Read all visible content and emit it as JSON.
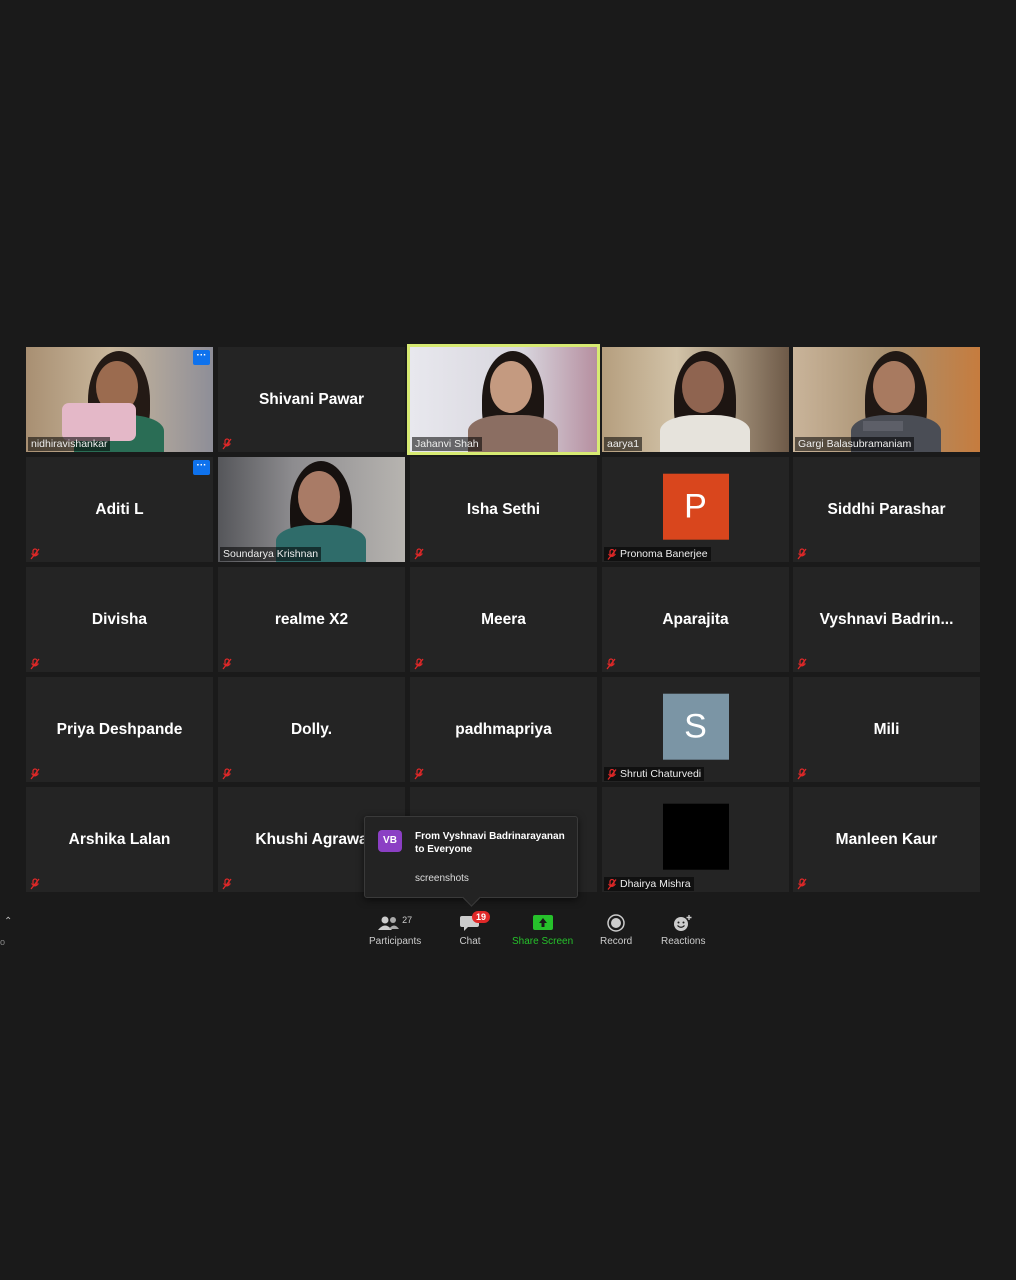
{
  "tiles": [
    {
      "name": "nidhiravishankar",
      "video": true,
      "muted": false,
      "more": true
    },
    {
      "name": "Shivani Pawar",
      "video": false,
      "muted": true
    },
    {
      "name": "Jahanvi Shah",
      "video": true,
      "muted": false,
      "active": true
    },
    {
      "name": "aarya1",
      "video": true,
      "muted": false
    },
    {
      "name": "Gargi Balasubramaniam",
      "video": true,
      "muted": false
    },
    {
      "name": "Aditi L",
      "video": false,
      "muted": true,
      "more": true
    },
    {
      "name": "Soundarya Krishnan",
      "video": true,
      "muted": false
    },
    {
      "name": "Isha Sethi",
      "video": false,
      "muted": true
    },
    {
      "name": "Pronoma Banerjee",
      "video": false,
      "muted": true,
      "avatar_letter": "P",
      "avatar_color": "#d9461d"
    },
    {
      "name": "Siddhi Parashar",
      "video": false,
      "muted": true
    },
    {
      "name": "Divisha",
      "video": false,
      "muted": true
    },
    {
      "name": "realme X2",
      "video": false,
      "muted": true
    },
    {
      "name": "Meera",
      "video": false,
      "muted": true
    },
    {
      "name": "Aparajita",
      "video": false,
      "muted": true
    },
    {
      "name": "Vyshnavi  Badrin...",
      "video": false,
      "muted": true
    },
    {
      "name": "Priya Deshpande",
      "video": false,
      "muted": true
    },
    {
      "name": "Dolly.",
      "video": false,
      "muted": true
    },
    {
      "name": "padhmapriya",
      "video": false,
      "muted": true
    },
    {
      "name": "Shruti Chaturvedi",
      "video": false,
      "muted": true,
      "avatar_letter": "S",
      "avatar_color": "#7b95a5"
    },
    {
      "name": "Mili",
      "video": false,
      "muted": true
    },
    {
      "name": "Arshika Lalan",
      "video": false,
      "muted": true
    },
    {
      "name": "Khushi Agrawa",
      "video": false,
      "muted": true
    },
    {
      "name": "",
      "video": false,
      "muted": false
    },
    {
      "name": "Dhairya Mishra",
      "video": false,
      "muted": true,
      "avatar_letter": "",
      "avatar_color": "#000000"
    },
    {
      "name": "Manleen Kaur",
      "video": false,
      "muted": true
    }
  ],
  "more_button_label": "···",
  "chat_popup": {
    "avatar_initials": "VB",
    "from": "From Vyshnavi Badrinarayanan to Everyone",
    "message": "screenshots"
  },
  "toolbar": {
    "participants": {
      "label": "Participants",
      "count": "27",
      "icon": "participants-icon"
    },
    "chat": {
      "label": "Chat",
      "badge": "19",
      "icon": "chat-icon"
    },
    "share_screen": {
      "label": "Share Screen",
      "icon": "share-screen-icon"
    },
    "record": {
      "label": "Record",
      "icon": "record-icon"
    },
    "reactions": {
      "label": "Reactions",
      "icon": "reactions-icon"
    }
  },
  "colors": {
    "background": "#1a1a1a",
    "tile": "#242424",
    "active_speaker": "#d7ea73",
    "share_green": "#26c12b",
    "badge_red": "#e02828",
    "mute_red": "#e02828"
  }
}
